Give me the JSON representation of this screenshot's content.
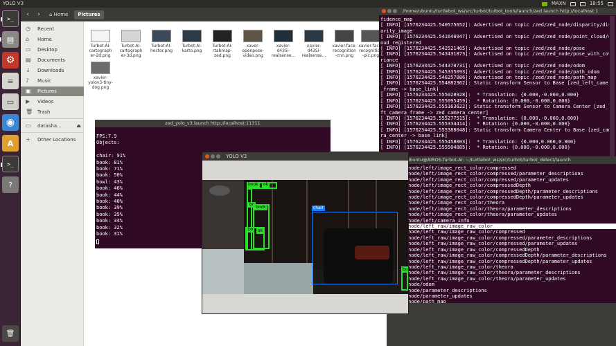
{
  "top_panel": {
    "app_title": "YOLO V3",
    "power_mode": "MAXN",
    "clock": "18:55"
  },
  "launcher": {
    "items": [
      {
        "name": "terminal-launcher",
        "glyph": ">_"
      },
      {
        "name": "files-launcher",
        "glyph": "▤"
      },
      {
        "name": "settings-launcher",
        "glyph": "⚙"
      },
      {
        "name": "text-editor-launcher",
        "glyph": "≡"
      },
      {
        "name": "drive-launcher",
        "glyph": "▭"
      },
      {
        "name": "chromium-launcher",
        "glyph": "◉"
      },
      {
        "name": "software-launcher",
        "glyph": "A"
      },
      {
        "name": "terminal-2-launcher",
        "glyph": ">_"
      },
      {
        "name": "unknown-launcher",
        "glyph": "?"
      },
      {
        "name": "trash-launcher",
        "glyph": "🗑"
      }
    ]
  },
  "files": {
    "breadcrumb_home": "Home",
    "breadcrumb_current": "Pictures",
    "sidebar": [
      {
        "label": "Recent",
        "icon": "clock-icon",
        "glyph": "◷"
      },
      {
        "label": "Home",
        "icon": "home-icon",
        "glyph": "⌂"
      },
      {
        "label": "Desktop",
        "icon": "desktop-icon",
        "glyph": "▭"
      },
      {
        "label": "Documents",
        "icon": "documents-icon",
        "glyph": "▤"
      },
      {
        "label": "Downloads",
        "icon": "downloads-icon",
        "glyph": "↓"
      },
      {
        "label": "Music",
        "icon": "music-icon",
        "glyph": "♪"
      },
      {
        "label": "Pictures",
        "icon": "pictures-icon",
        "glyph": "▣"
      },
      {
        "label": "Videos",
        "icon": "videos-icon",
        "glyph": "▶"
      },
      {
        "label": "Trash",
        "icon": "trash-icon",
        "glyph": "🗑"
      },
      {
        "label": "datasha...",
        "icon": "drive-icon",
        "glyph": "▭"
      },
      {
        "label": "Other Locations",
        "icon": "plus-icon",
        "glyph": "+"
      }
    ],
    "items": [
      {
        "line1": "Turbot-AI-",
        "line2": "cartograph",
        "line3": "er-2d.png"
      },
      {
        "line1": "Turbot-AI-",
        "line2": "cartograph",
        "line3": "er-3d.png"
      },
      {
        "line1": "Turbot-AI-",
        "line2": "hector.png",
        "line3": ""
      },
      {
        "line1": "Turbot-AI-",
        "line2": "karto.png",
        "line3": ""
      },
      {
        "line1": "Turbot-AI-",
        "line2": "rtabmap-",
        "line3": "zed.png"
      },
      {
        "line1": "xaver-",
        "line2": "openpose-",
        "line3": "video.png"
      },
      {
        "line1": "xavier-",
        "line2": "d435i-",
        "line3": "realsense..."
      },
      {
        "line1": "xavier-",
        "line2": "d435i-",
        "line3": "realsense..."
      },
      {
        "line1": "xavier-face-",
        "line2": "recognition",
        "line3": "-cnn.png"
      },
      {
        "line1": "xavier-face-",
        "line2": "recognition",
        "line3": "-pic.png"
      },
      {
        "line1": "xavier-",
        "line2": "yolov3-tiny-",
        "line3": "dog.png"
      }
    ]
  },
  "zed_launch": {
    "title": "/home/ubuntu/turtlebot_ws/src/turbot/turbot_tools/launch/zed.launch http://localhost:1",
    "lines": [
      "fidence_map",
      "[ INFO] [1576234425.540575652]: Advertised on topic /zed/zed_node/disparity/disp",
      "arity_image",
      "[ INFO] [1576234425.541640947]: Advertised on topic /zed/zed_node/point_cloud/cl",
      "oud_registered",
      "[ INFO] [1576234425.542521465]: Advertised on topic /zed/zed_node/pose",
      "[ INFO] [1576234425.543431873]: Advertised on topic /zed/zed_node/pose_with_cova",
      "riance",
      "[ INFO] [1576234425.544370731]: Advertised on topic /zed/zed_node/odom",
      "[ INFO] [1576234425.545335093]: Advertised on topic /zed/zed_node/path_odom",
      "[ INFO] [1576234425.546257086]: Advertised on topic /zed/zed_node/path_map",
      "[ INFO] [1576234425.554882362]: Static transform Sensor to Base [zed_left_camera",
      "_frame -> base_link]",
      "[ INFO] [1576234425.555028928]:  * Translation: {0.000,-0.060,0.000}",
      "[ INFO] [1576234425.555095459]:  * Rotation: {0.000,-0.000,0.000}",
      "[ INFO] [1576234425.555163622]: Static transform Sensor to Camera Center [zed_le",
      "ft_camera_frame -> zed_camera_center]",
      "[ INFO] [1576234425.555277515]:  * Translation: {0.000,-0.060,0.000}",
      "[ INFO] [1576234425.555334414]:  * Rotation: {0.000,-0.000,0.000}",
      "[ INFO] [1576234425.555388048]: Static transform Camera Center to Base [zed_came",
      "ra_center -> base_link]",
      "[ INFO] [1576234425.555458003]:  * Translation: {0.000,0.060,0.000}",
      "[ INFO] [1576234425.555504885]:  * Rotation: {0.000,-0.000,0.000}"
    ]
  },
  "topics_term": {
    "title": "ubuntu@AIROS-Turbot-AI: ~/turtlebot_ws/src/turbot/turbot_detect/launch",
    "lines": [
      "node/left/image_rect_color/compressed",
      "node/left/image_rect_color/compressed/parameter_descriptions",
      "node/left/image_rect_color/compressed/parameter_updates",
      "node/left/image_rect_color/compressedDepth",
      "node/left/image_rect_color/compressedDepth/parameter_descriptions",
      "node/left/image_rect_color/compressedDepth/parameter_updates",
      "node/left/image_rect_color/theora",
      "node/left/image_rect_color/theora/parameter_descriptions",
      "node/left/image_rect_color/theora/parameter_updates",
      "node/left/camera_info",
      "node/left_raw/image_raw_color",
      "node/left_raw/image_raw_color/compressed",
      "node/left_raw/image_raw_color/compressed/parameter_descriptions",
      "node/left_raw/image_raw_color/compressed/parameter_updates",
      "node/left_raw/image_raw_color/compressedDepth",
      "node/left_raw/image_raw_color/compressedDepth/parameter_descriptions",
      "node/left_raw/image_raw_color/compressedDepth/parameter_updates",
      "node/left_raw/image_raw_color/theora",
      "node/left_raw/image_raw_color/theora/parameter_descriptions",
      "node/left_raw/image_raw_color/theora/parameter_updates",
      "node/odom",
      "node/parameter_descriptions",
      "node/parameter_updates",
      "node/path_map"
    ],
    "highlight_index": 10
  },
  "yolo_term": {
    "title": "zed_yolo_v3.launch http://localhost:11311",
    "lines": [
      "FPS:7.9",
      "Objects:",
      "",
      "chair: 91%",
      "book: 81%",
      "book: 71%",
      "book: 50%",
      "bowl: 43%",
      "book: 46%",
      "book: 44%",
      "book: 40%",
      "book: 39%",
      "book: 35%",
      "book: 34%",
      "book: 32%",
      "book: 31%"
    ]
  },
  "yolo_window": {
    "title": "YOLO V3",
    "detections": [
      {
        "label": "book",
        "color": "#28e028"
      },
      {
        "label": "ok",
        "color": "#28e028"
      },
      {
        "label": "bo",
        "color": "#28e028"
      },
      {
        "label": "book",
        "color": "#28e028"
      },
      {
        "label": "bo",
        "color": "#28e028"
      },
      {
        "label": "ok",
        "color": "#28e028"
      },
      {
        "label": "chair",
        "color": "#1e7bf0"
      },
      {
        "label": "bo",
        "color": "#28e028"
      }
    ]
  }
}
